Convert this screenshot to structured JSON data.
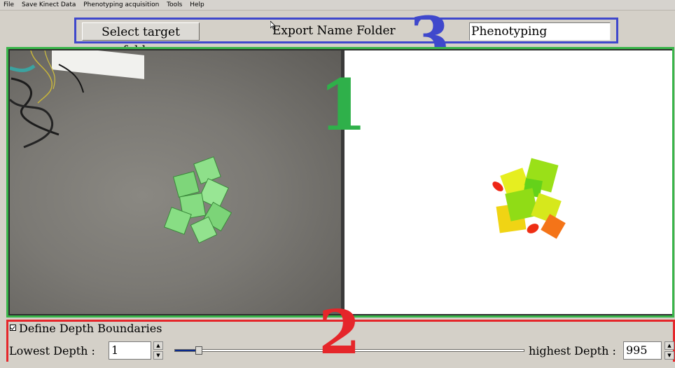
{
  "menubar": {
    "items": [
      "File",
      "Save Kinect Data",
      "Phenotyping acquisition",
      "Tools",
      "Help"
    ]
  },
  "toolbar": {
    "select_folder_label": "Select target folder",
    "export_label": "Export Name Folder",
    "export_name_value": "Phenotyping"
  },
  "annotations": {
    "view_number": "1",
    "depth_number": "2",
    "toolbar_number": "3"
  },
  "depth_panel": {
    "checkbox_label": "Define Depth Boundaries",
    "checkbox_checked": true,
    "lowest_label": "Lowest Depth :",
    "lowest_value": "1",
    "highest_label": "highest Depth :",
    "highest_value": "995",
    "slider_fraction": 0.001
  },
  "colors": {
    "green_frame": "#39b54a",
    "red_frame": "#e5262a",
    "blue_frame": "#3f48cc",
    "slider_fill": "#0a2a8c"
  }
}
